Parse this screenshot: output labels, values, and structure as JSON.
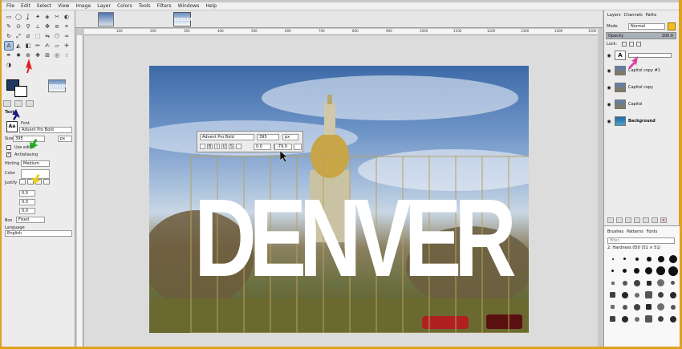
{
  "menu": [
    "File",
    "Edit",
    "Select",
    "View",
    "Image",
    "Layer",
    "Colors",
    "Tools",
    "Filters",
    "Windows",
    "Help"
  ],
  "canvas_tab": {
    "thumb_text": "DENVER"
  },
  "toolbox": {
    "icons": [
      "rect-select-icon",
      "ellipse-select-icon",
      "lasso-icon",
      "wand-icon",
      "color-select-icon",
      "scissors-icon",
      "foreground-select-icon",
      "paths-icon",
      "color-picker-icon",
      "zoom-icon",
      "measure-icon",
      "move-icon",
      "align-icon",
      "crop-icon",
      "rotate-icon",
      "scale-icon",
      "shear-icon",
      "perspective-icon",
      "flip-icon",
      "cage-icon",
      "warp-icon",
      "text-icon",
      "bucket-fill-icon",
      "blend-icon",
      "pencil-icon",
      "paintbrush-icon",
      "eraser-icon",
      "airbrush-icon",
      "ink-icon",
      "mypaint-icon",
      "clone-icon",
      "heal-icon",
      "perspective-clone-icon",
      "blur-icon",
      "smudge-icon",
      "dodge-burn-icon"
    ],
    "active_index": 21
  },
  "text_options": {
    "section_label": "Text",
    "font_label": "Font",
    "font_value": "Advent Pro Bold",
    "size_label": "Size",
    "size_value": "395",
    "size_unit": "px",
    "use_editor_label": "Use editor",
    "antialiasing_label": "Antialiasing",
    "hinting_label": "Hinting",
    "hinting_value": "Medium",
    "color_label": "Color",
    "justify_label": "Justify",
    "indent_value": "0.0",
    "line_spacing_value": "0.0",
    "letter_spacing_value": "0.0",
    "box_label": "Box",
    "box_value": "Fixed",
    "language_label": "Language",
    "language_value": "English"
  },
  "text_toolbar": {
    "font": "Advent Pro Bold",
    "size": "395",
    "unit": "px",
    "baseline": "0.0",
    "kerning": "-79.0"
  },
  "canvas_text": "DENVER",
  "rulers": {
    "top": [
      "100",
      "200",
      "300",
      "400",
      "500",
      "600",
      "700",
      "800",
      "900",
      "1000",
      "1100",
      "1200",
      "1300",
      "1400",
      "1500"
    ]
  },
  "right_panel": {
    "tabs": [
      "Layers",
      "Channels",
      "Paths"
    ],
    "mode_label": "Mode",
    "mode_value": "Normal",
    "opacity_label": "Opacity",
    "opacity_value": "100.0",
    "lock_label": "Lock:",
    "layers": [
      {
        "name": "Capitol copy #1",
        "kind": "photo"
      },
      {
        "name": "Capitol copy",
        "kind": "photo"
      },
      {
        "name": "Capitol",
        "kind": "photo"
      },
      {
        "name": "Background",
        "kind": "bg",
        "bold": true
      }
    ],
    "text_layer_glyph": "A",
    "brush_tabs": [
      "Brushes",
      "Patterns",
      "Fonts"
    ],
    "brush_filter_placeholder": "filter",
    "brush_name": "2. Hardness 050 (51 × 51)"
  }
}
